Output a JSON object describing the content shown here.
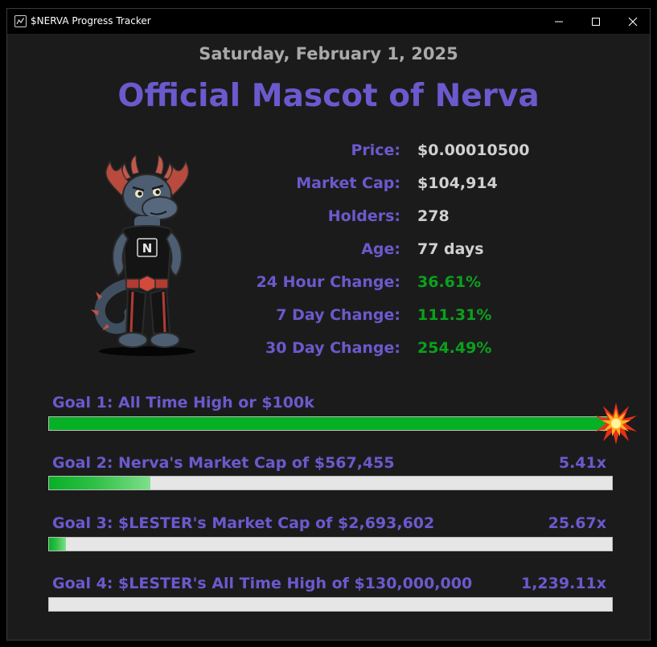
{
  "window": {
    "title": "$NERVA Progress Tracker",
    "icon": "chart-line-icon",
    "controls": [
      "minimize-icon",
      "maximize-icon",
      "close-icon"
    ]
  },
  "date": "Saturday, February 1, 2025",
  "title": "Official Mascot of Nerva",
  "mascot": {
    "description_icon": "dragon-mascot",
    "badge_letter": "N"
  },
  "stats": [
    {
      "label": "Price:",
      "value": "$0.00010500",
      "status": "neutral"
    },
    {
      "label": "Market Cap:",
      "value": "$104,914",
      "status": "neutral"
    },
    {
      "label": "Holders:",
      "value": "278",
      "status": "neutral"
    },
    {
      "label": "Age:",
      "value": "77 days",
      "status": "neutral"
    },
    {
      "label": "24 Hour Change:",
      "value": "36.61%",
      "status": "positive"
    },
    {
      "label": "7 Day Change:",
      "value": "111.31%",
      "status": "positive"
    },
    {
      "label": "30 Day Change:",
      "value": "254.49%",
      "status": "positive"
    }
  ],
  "goals": [
    {
      "label": "Goal 1: All Time High or $100k",
      "multiplier": "",
      "progress": 1.0,
      "achieved": true,
      "achieved_icon": "starburst-icon"
    },
    {
      "label": "Goal 2: Nerva's Market Cap of $567,455",
      "multiplier": "5.41x",
      "progress": 0.18,
      "achieved": false
    },
    {
      "label": "Goal 3: $LESTER's Market Cap of $2,693,602",
      "multiplier": "25.67x",
      "progress": 0.03,
      "achieved": false
    },
    {
      "label": "Goal 4: $LESTER's All Time High of $130,000,000",
      "multiplier": "1,239.11x",
      "progress": 0.0,
      "achieved": false
    }
  ],
  "colors": {
    "background": "#1c1b1c",
    "accent": "#6a5acd",
    "date_text": "#a9a9a9",
    "neutral_value": "#d0d0d0",
    "positive_value": "#0aa11c",
    "progress_fill": "#06b025",
    "progress_track": "#e6e6e6"
  }
}
